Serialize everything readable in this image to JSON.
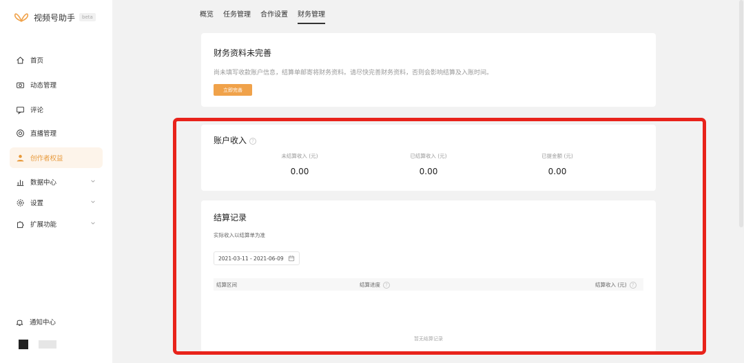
{
  "app": {
    "name": "视频号助手",
    "badge": "beta"
  },
  "sidebar": {
    "items": [
      {
        "label": "首页",
        "icon": "home-icon"
      },
      {
        "label": "动态管理",
        "icon": "camera-icon"
      },
      {
        "label": "评论",
        "icon": "comment-icon"
      },
      {
        "label": "直播管理",
        "icon": "live-icon"
      },
      {
        "label": "创作者权益",
        "icon": "creator-icon",
        "active": true
      },
      {
        "label": "数据中心",
        "icon": "chart-icon",
        "expandable": true
      },
      {
        "label": "设置",
        "icon": "gear-icon",
        "expandable": true
      },
      {
        "label": "扩展功能",
        "icon": "puzzle-icon",
        "expandable": true
      }
    ],
    "notify_label": "通知中心"
  },
  "tabs": [
    {
      "label": "概览"
    },
    {
      "label": "任务管理"
    },
    {
      "label": "合作设置"
    },
    {
      "label": "财务管理",
      "active": true
    }
  ],
  "finance_notice": {
    "title": "财务资料未完善",
    "description": "尚未填写收款账户信息，结算单邮寄将财务资料。请尽快完善财务资料，否则会影响结算及入账时间。",
    "button_label": "立即完善"
  },
  "account_income": {
    "title": "账户收入",
    "stats": [
      {
        "label": "未结算收入 (元)",
        "value": "0.00"
      },
      {
        "label": "已结算收入 (元)",
        "value": "0.00"
      },
      {
        "label": "已提金额 (元)",
        "value": "0.00"
      }
    ]
  },
  "settlement": {
    "title": "结算记录",
    "subtitle": "实际收入以结算单为准",
    "date_range": "2021-03-11 - 2021-06-09",
    "columns": [
      "结算区间",
      "结算进度",
      "结算收入 (元)"
    ],
    "empty_text": "暂无结算记录"
  },
  "colors": {
    "accent": "#f0a24a",
    "highlight": "#e8231b",
    "active_bg": "#fdf4ea"
  }
}
